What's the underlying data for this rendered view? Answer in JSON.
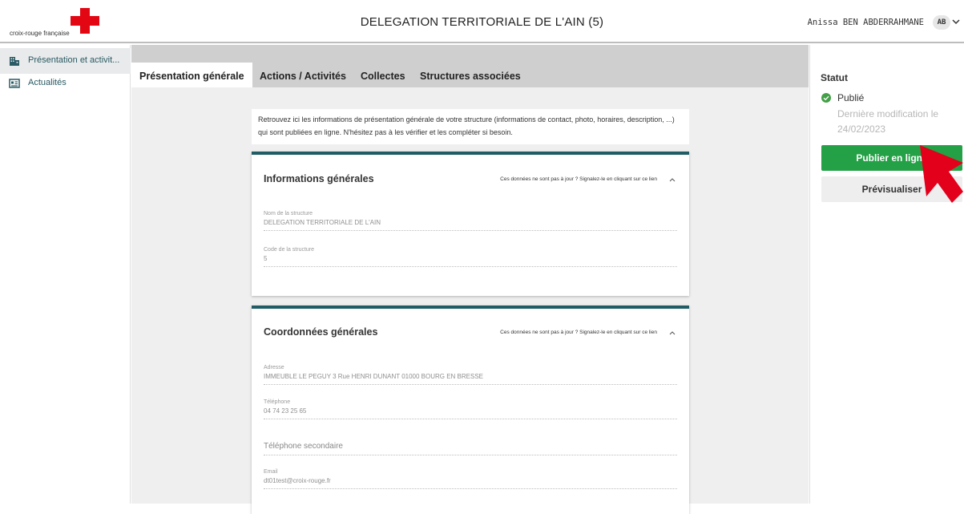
{
  "header": {
    "brand": "croix-rouge française",
    "title": "DELEGATION TERRITORIALE DE L'AIN (5)",
    "user_name": "Anissa BEN ABDERRAHMANE",
    "avatar_initials": "AB"
  },
  "sidebar": {
    "items": [
      {
        "label": "Présentation et activit...",
        "icon": "building-icon",
        "active": true
      },
      {
        "label": "Actualités",
        "icon": "newspaper-icon",
        "active": false
      }
    ]
  },
  "tabs": [
    {
      "label": "Présentation générale",
      "active": true
    },
    {
      "label": "Actions / Activités"
    },
    {
      "label": "Collectes"
    },
    {
      "label": "Structures associées"
    }
  ],
  "intro": "Retrouvez ici les informations de présentation générale de votre structure (informations de contact, photo, horaires, description, ...) qui sont publiées en ligne. N'hésitez pas à les vérifier et les compléter si besoin.",
  "cards": {
    "general": {
      "title": "Informations générales",
      "link": "Ces données ne sont pas à jour ? Signalez-le en cliquant sur ce lien",
      "fields": [
        {
          "label": "Nom de la structure",
          "value": "DELEGATION TERRITORIALE DE L'AIN"
        },
        {
          "label": "Code de la structure",
          "value": "5"
        }
      ]
    },
    "coordonnees": {
      "title": "Coordonnées générales",
      "link": "Ces données ne sont pas à jour ? Signalez-le en cliquant sur ce lien",
      "fields": [
        {
          "label": "Adresse",
          "value": "IMMEUBLE  LE PEGUY  3 Rue HENRI DUNANT 01000 BOURG EN BRESSE"
        },
        {
          "label": "Téléphone",
          "value": "04 74 23 25 65"
        },
        {
          "placeholder": "Téléphone secondaire"
        },
        {
          "label": "Email",
          "value": "dt01test@croix-rouge.fr"
        }
      ]
    }
  },
  "status": {
    "title": "Statut",
    "state": "Publié",
    "modified": "Dernière modification le 24/02/2023",
    "publish_label": "Publier en ligne",
    "preview_label": "Prévisualiser"
  },
  "colors": {
    "accent": "#1f5c66",
    "publish": "#24a047",
    "brand_red": "#e30613",
    "arrow_red": "#e3001b"
  }
}
